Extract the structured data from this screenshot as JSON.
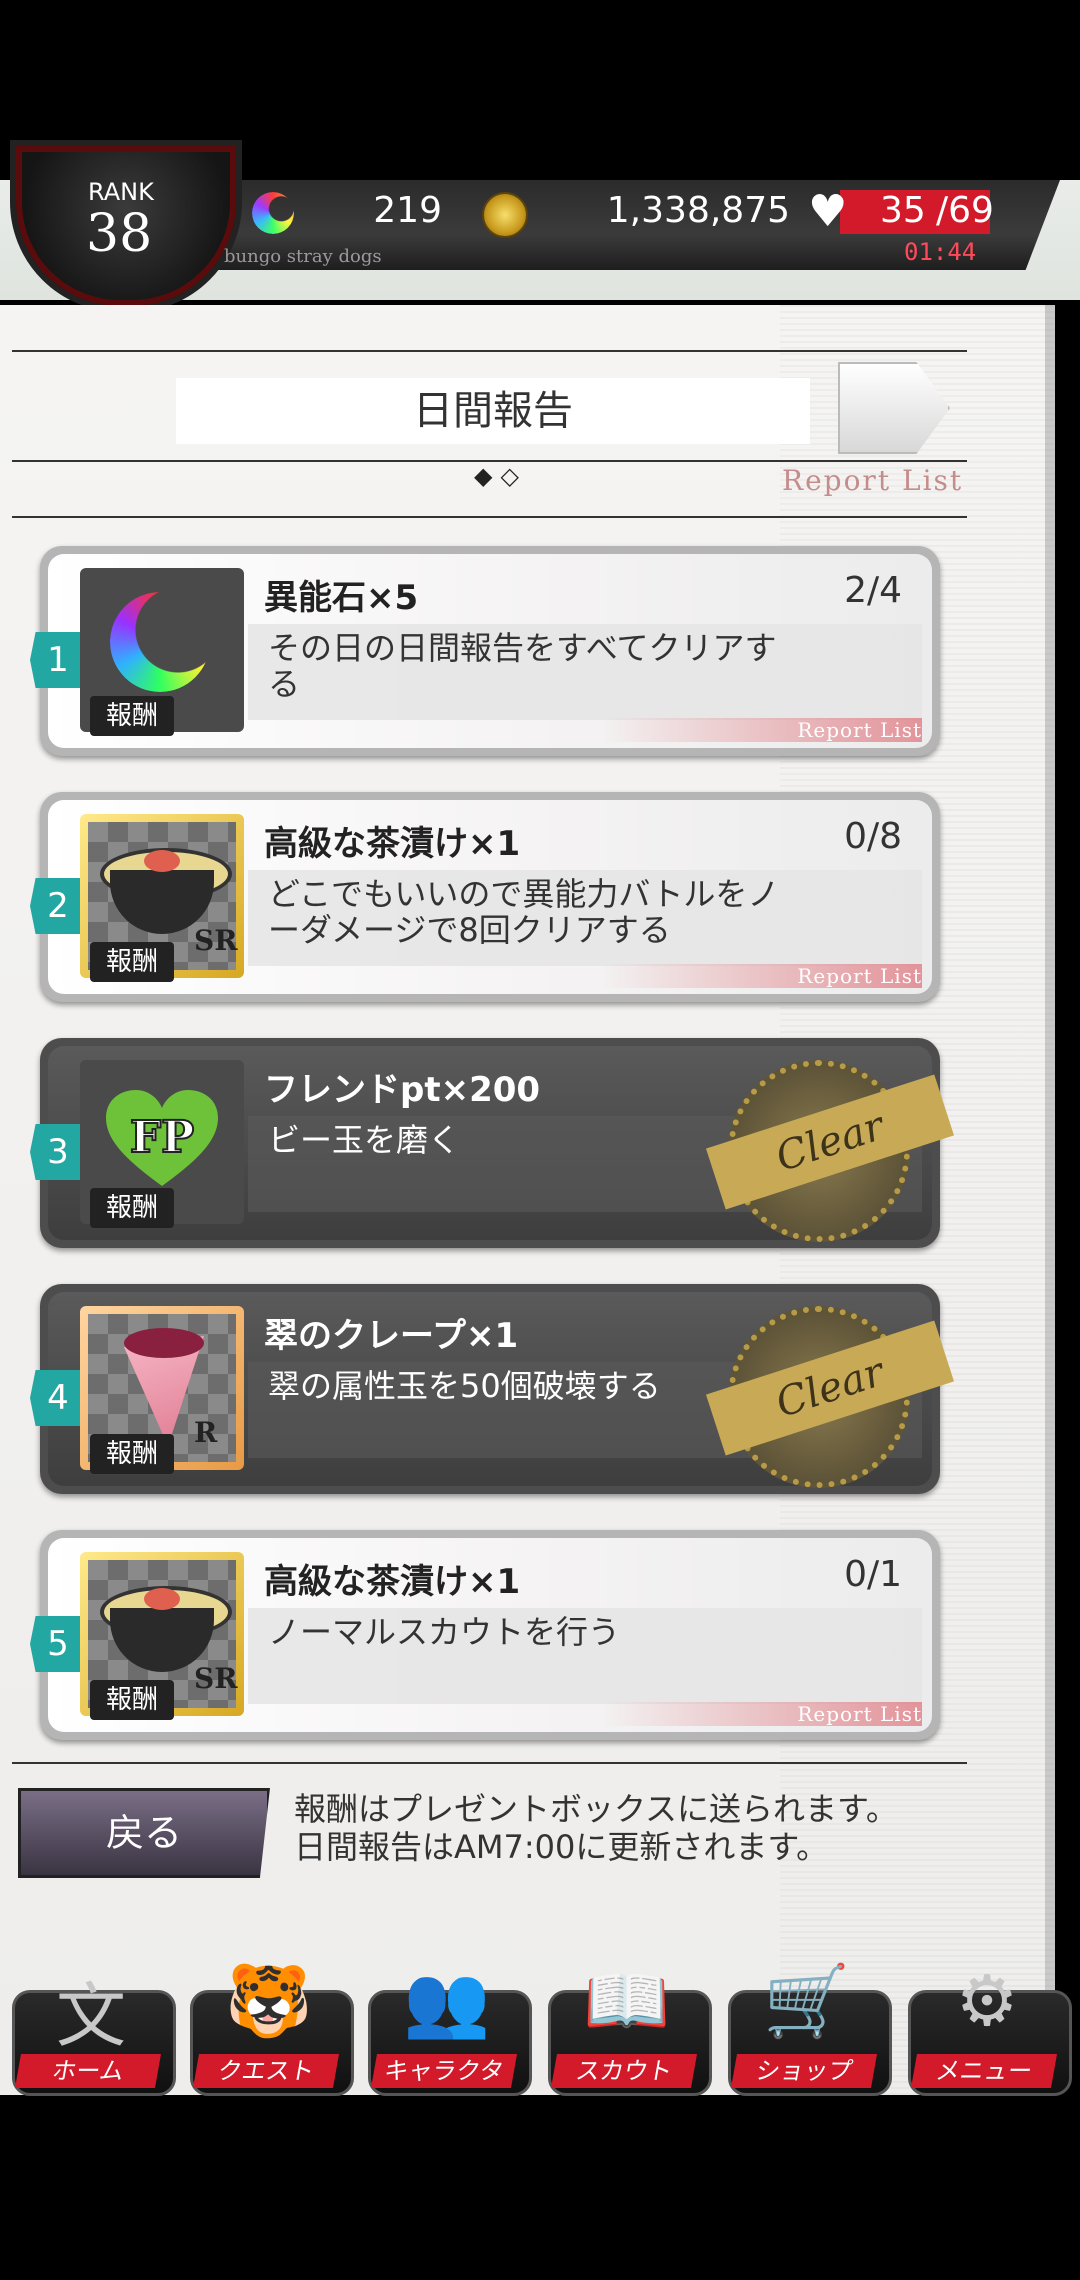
{
  "hud": {
    "rank_label": "RANK",
    "rank_value": "38",
    "gems": "219",
    "coins": "1,338,875",
    "stamina_current": "35",
    "stamina_max": "/69",
    "stamina_timer": "01:44",
    "brand_sub": "bungo stray dogs"
  },
  "page": {
    "title": "日間報告",
    "dots": "◆◇",
    "report_list": "Report List"
  },
  "cards": [
    {
      "num": "1",
      "reward": "異能石×5",
      "progress": "2/4",
      "desc": "その日の日間報告をすべてクリアする",
      "tag": "報酬",
      "rarity": "",
      "link": "Report List",
      "cleared": false,
      "icon": "rainbow-moon-icon"
    },
    {
      "num": "2",
      "reward": "高級な茶漬け×1",
      "progress": "0/8",
      "desc": "どこでもいいので異能力バトルをノーダメージで8回クリアする",
      "tag": "報酬",
      "rarity": "SR",
      "link": "Report List",
      "cleared": false,
      "icon": "chazuke-bowl-icon"
    },
    {
      "num": "3",
      "reward": "フレンドpt×200",
      "progress": "",
      "desc": "ビー玉を磨く",
      "tag": "報酬",
      "rarity": "",
      "link": "",
      "cleared": true,
      "icon": "fp-heart-icon",
      "stamp": "Clear"
    },
    {
      "num": "4",
      "reward": "翠のクレープ×1",
      "progress": "",
      "desc": "翠の属性玉を50個破壊する",
      "tag": "報酬",
      "rarity": "R",
      "link": "",
      "cleared": true,
      "icon": "crepe-icon",
      "stamp": "Clear"
    },
    {
      "num": "5",
      "reward": "高級な茶漬け×1",
      "progress": "0/1",
      "desc": "ノーマルスカウトを行う",
      "tag": "報酬",
      "rarity": "SR",
      "link": "Report List",
      "cleared": false,
      "icon": "chazuke-bowl-icon"
    }
  ],
  "footer": {
    "back": "戻る",
    "notice_line1": "報酬はプレゼントボックスに送られます。",
    "notice_line2": "日間報告はAM7:00に更新されます。"
  },
  "nav": [
    {
      "label": "ホーム",
      "glyph": "文",
      "icon": "home-icon"
    },
    {
      "label": "クエスト",
      "glyph": "🐯",
      "icon": "tiger-icon"
    },
    {
      "label": "キャラクター",
      "glyph": "👥",
      "icon": "characters-icon"
    },
    {
      "label": "スカウト",
      "glyph": "📖",
      "icon": "book-icon"
    },
    {
      "label": "ショップ",
      "glyph": "🛒",
      "icon": "cart-icon"
    },
    {
      "label": "メニュー",
      "glyph": "⚙",
      "icon": "gear-icon"
    }
  ],
  "colors": {
    "teal_badge": "#22a7a3",
    "stamina_red": "#d31a2a",
    "gold_stamp": "#c8a955"
  }
}
